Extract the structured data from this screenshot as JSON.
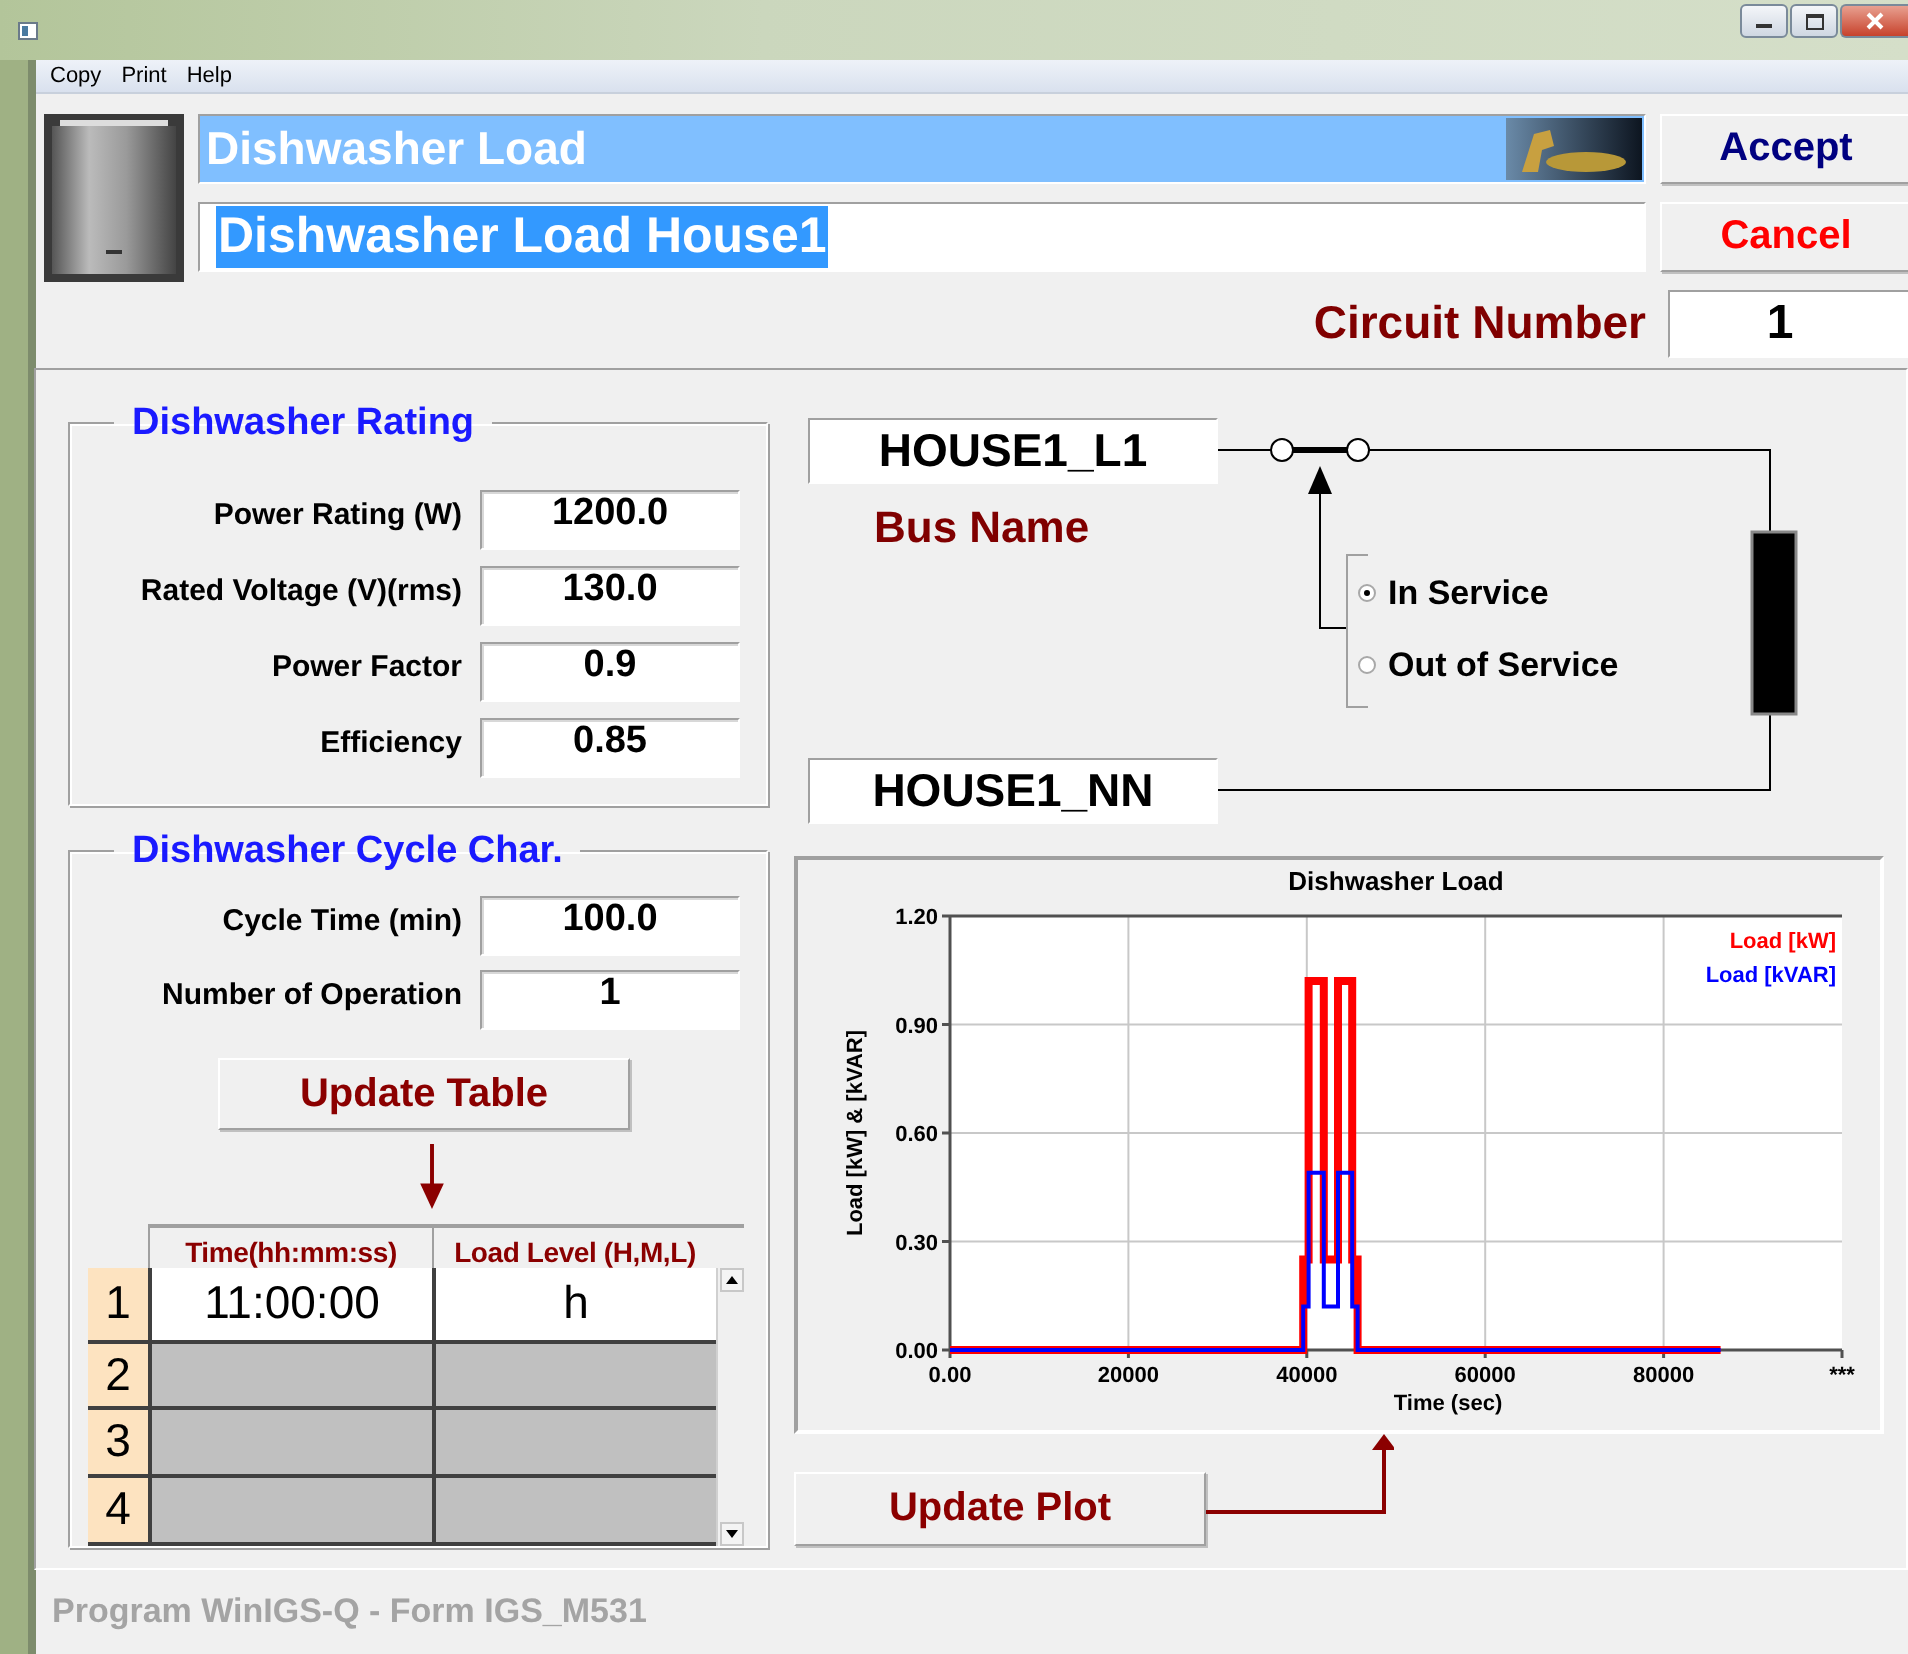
{
  "window": {
    "menu": [
      "Copy",
      "Print",
      "Help"
    ]
  },
  "header": {
    "title": "Dishwasher Load",
    "name": "Dishwasher Load House1",
    "buttons": [
      {
        "label": "Accept",
        "kind": "accept"
      },
      {
        "label": "Cancel",
        "kind": "cancel"
      }
    ],
    "circuit_label": "Circuit Number",
    "circuit_value": "1"
  },
  "rating": {
    "title": "Dishwasher Rating",
    "fields": [
      {
        "label": "Power Rating (W)",
        "value": "1200.0"
      },
      {
        "label": "Rated Voltage (V)(rms)",
        "value": "130.0"
      },
      {
        "label": "Power Factor",
        "value": "0.9"
      },
      {
        "label": "Efficiency",
        "value": "0.85"
      }
    ]
  },
  "cycle": {
    "title": "Dishwasher Cycle Char.",
    "fields": [
      {
        "label": "Cycle Time (min)",
        "value": "100.0"
      },
      {
        "label": "Number of Operation",
        "value": "1"
      }
    ],
    "update_button": "Update Table",
    "table": {
      "columns": [
        "Time(hh:mm:ss)",
        "Load Level (H,M,L)"
      ],
      "rows": [
        {
          "index": "1",
          "cells": [
            "11:00:00",
            "h"
          ],
          "filled": true
        },
        {
          "index": "2",
          "filled": false
        },
        {
          "index": "3",
          "filled": false
        },
        {
          "index": "4",
          "filled": false
        }
      ]
    }
  },
  "bus": {
    "from": "HOUSE1_L1",
    "label": "Bus Name",
    "to": "HOUSE1_NN",
    "services": [
      {
        "label": "In Service",
        "selected": true
      },
      {
        "label": "Out of Service",
        "selected": false
      }
    ]
  },
  "plot": {
    "chart_data": {
      "type": "line",
      "grid": true,
      "title": "Dishwasher Load",
      "xlabel": "Time (sec)",
      "ylabel": "Load [kW] & [kVAR]",
      "x": [
        0,
        39600,
        39600,
        40200,
        40200,
        41900,
        41900,
        43500,
        43500,
        45100,
        45100,
        45700,
        45700,
        86400
      ],
      "series": [
        {
          "name": "Load [kW]",
          "color": "#ff0000",
          "values": [
            0,
            0,
            0.25,
            0.25,
            1.02,
            1.02,
            0.25,
            0.25,
            1.02,
            1.02,
            0.25,
            0.25,
            0,
            0
          ]
        },
        {
          "name": "Load [kVAR]",
          "color": "#0000ff",
          "values": [
            0,
            0,
            0.12,
            0.12,
            0.49,
            0.49,
            0.12,
            0.12,
            0.49,
            0.49,
            0.12,
            0.12,
            0,
            0
          ]
        }
      ],
      "xlim": [
        0,
        100000
      ],
      "ylim": [
        0,
        1.2
      ],
      "xticks": [
        {
          "value": 0,
          "label": "0.00"
        },
        20000,
        40000,
        60000,
        80000,
        {
          "value": 100000,
          "label": "***"
        }
      ],
      "yticks": [
        {
          "value": 0,
          "label": "0.00"
        },
        {
          "value": 0.3,
          "label": "0.30"
        },
        {
          "value": 0.6,
          "label": "0.60"
        },
        {
          "value": 0.9,
          "label": "0.90"
        },
        {
          "value": 1.2,
          "label": "1.20"
        }
      ]
    },
    "update_button": "Update Plot"
  },
  "status_bar": "Program WinIGS-Q - Form IGS_M531"
}
